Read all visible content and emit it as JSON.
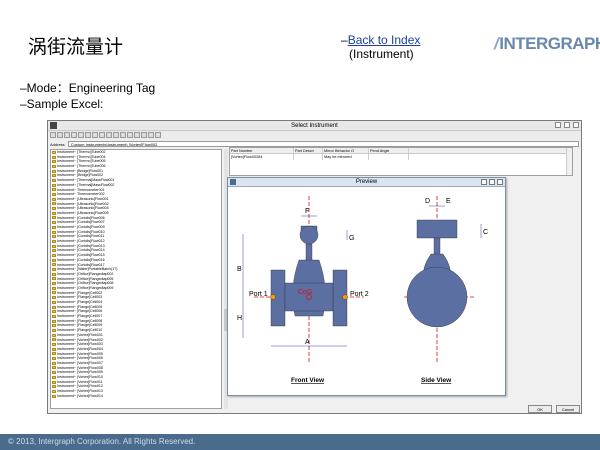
{
  "slide": {
    "title": "涡街流量计",
    "back_prefix": "–",
    "back_link": "Back to Index",
    "back_sub": "(Instrument)",
    "logo_slash": "/",
    "logo_text": "INTERGRAPH",
    "bullets": [
      "–Mode：Engineering Tag",
      "–Sample Excel:"
    ],
    "footer": "© 2013, Intergraph Corporation. All Rights Reserved."
  },
  "window": {
    "title": "Select Instrument",
    "address_label": "Address",
    "address_value": "Custom Instruments\\Instrument\\ [Vortex]Flow002",
    "grid_headers": [
      "Part Number",
      "Part Descri",
      "Mirror Behavior O",
      "Pend Angle"
    ],
    "grid_row": [
      "[Vortex]Flow00284",
      "",
      "May be mirrored",
      ""
    ],
    "ok_label": "OK",
    "cancel_label": "Cancel",
    "tree_items": [
      "Instrument~ [Thermo]Tube002",
      "Instrument~ [Thermo]Tube004",
      "Instrument~ [Thermo]Tube005",
      "Instrument~ [Thermo]Tube006",
      "Instrument~ [Bridge]Flow001",
      "Instrument~ [Bridge]Flow002",
      "Instrument~ [Thermal]MassFlow001",
      "Instrument~ [Thermal]MassFlow002",
      "Instrument~ Thermometer001",
      "Instrument~ Thermometer002",
      "Instrument~ [Ultrasonic]Flow001",
      "Instrument~ [Ultrasonic]Flow002",
      "Instrument~ [Ultrasonic]Flow004",
      "Instrument~ [Ultrasonic]Flow005",
      "Instrument~ [Coriolis]Flow006",
      "Instrument~ [Coriolis]Flow007",
      "Instrument~ [Coriolis]Flow009",
      "Instrument~ [Coriolis]Flow010",
      "Instrument~ [Coriolis]Flow011",
      "Instrument~ [Coriolis]Flow012",
      "Instrument~ [Coriolis]Flow013",
      "Instrument~ [Coriolis]Flow014",
      "Instrument~ [Coriolis]Flow015",
      "Instrument~ [Coriolis]Flow016",
      "Instrument~ [Coriolis]Flow017",
      "Instrument~ [Wafer]PortableBatch(17)",
      "Instrument~ [Orifice]Flangedtap002",
      "Instrument~ [Orifice]Flangedtap005",
      "Instrument~ [Orifice]Flangedtap008",
      "Instrument~ [Orifice]Flangedtap009",
      "Instrument~ [Flange]Cell002",
      "Instrument~ [Flange]Cell003",
      "Instrument~ [Flange]Cell004",
      "Instrument~ [Flange]Cell005",
      "Instrument~ [Flange]Cell006",
      "Instrument~ [Flange]Cell007",
      "Instrument~ [Flange]Cell008",
      "Instrument~ [Flange]Cell009",
      "Instrument~ [Flange]Cell010",
      "Instrument~ [Vortex]Flow001",
      "Instrument~ [Vortex]Flow002",
      "Instrument~ [Vortex]Flow003",
      "Instrument~ [Vortex]Flow004",
      "Instrument~ [Vortex]Flow005",
      "Instrument~ [Vortex]Flow006",
      "Instrument~ [Vortex]Flow007",
      "Instrument~ [Vortex]Flow008",
      "Instrument~ [Vortex]Flow009",
      "Instrument~ [Vortex]Flow010",
      "Instrument~ [Vortex]Flow011",
      "Instrument~ [Vortex]Flow012",
      "Instrument~ [Vortex]Flow013",
      "Instrument~ [Vortex]Flow014"
    ]
  },
  "preview": {
    "title": "Preview",
    "front_label": "Front View",
    "side_label": "Side View",
    "port1": "Port 1",
    "port2": "Port 2",
    "cog": "CoG",
    "dims": {
      "a": "A",
      "b": "B",
      "c": "C",
      "d": "D",
      "e": "E",
      "f": "F",
      "g": "G",
      "h": "H"
    }
  },
  "colors": {
    "accent_link": "#1a3f9c",
    "footer_bg": "#4a6c8c",
    "body_fill": "#5b6fa3",
    "port_marker": "#ff9900",
    "cog_red": "#e01010",
    "dim_blue": "#3a3aa0"
  }
}
